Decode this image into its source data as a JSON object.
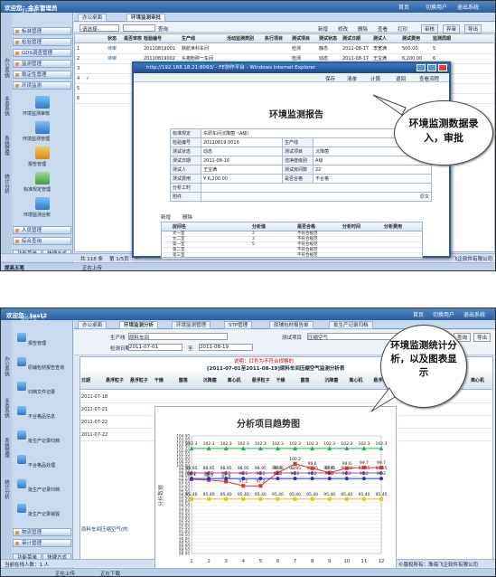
{
  "s1": {
    "banner": {
      "welcome": "欢迎您：金东管理员",
      "sub": "当前单位：A",
      "links": [
        "首页",
        "切换用户",
        "退出系统"
      ]
    },
    "tab": "办公桌面",
    "tab2": "环境监测审批",
    "filter": {
      "select": "-请选择-",
      "btn": "查询"
    },
    "toolbar": [
      "新增",
      "修改",
      "删除",
      "查看",
      "打印",
      "审核",
      "弃审",
      "导出"
    ],
    "cols": [
      "",
      "",
      "状态",
      "是否审核",
      "检验编号",
      "生产线",
      "活动监测类别",
      "执行项目",
      "测试项目",
      "测试状态",
      "测试日期",
      "测试人",
      "测试费用",
      "监测周期"
    ],
    "rows": [
      [
        "1",
        "",
        "待审",
        "",
        "20110819001",
        "默航世科车间",
        "",
        "",
        "检测",
        "静态",
        "2011-08-17",
        "李宽满",
        "500.00",
        "5"
      ],
      [
        "2",
        "",
        "待审",
        "",
        "20110819002",
        "头孢粉碎一车间",
        "",
        "",
        "检测",
        "动态",
        "2011-08-17",
        "王宝满",
        "6,200.00",
        "6"
      ],
      [
        "3",
        "",
        "",
        "",
        "",
        "",
        "",
        "",
        "",
        "",
        "",
        "",
        "",
        ""
      ],
      [
        "4",
        "✓",
        "",
        "",
        "",
        "",
        "",
        "",
        "",
        "",
        "",
        "",
        "",
        ""
      ],
      [
        "5",
        "",
        "",
        "",
        "",
        "",
        "",
        "",
        "",
        "",
        "",
        "",
        "",
        ""
      ],
      [
        "6",
        "",
        "",
        "",
        "",
        "",
        "",
        "",
        "",
        "",
        "",
        "",
        "",
        ""
      ]
    ],
    "status": [
      "共 118 条",
      "第 1/5页",
      "10"
    ],
    "status_right": "飞企软件有限公司",
    "taskbar": [
      "提高五笔",
      "正在上传"
    ],
    "side": {
      "vtabs": [
        "办公系统",
        "业务系统",
        "系统管理",
        "统计分析"
      ],
      "mods": [
        "标准管理",
        "检验管理",
        "GDS调查管理",
        "监测管理",
        "稳定性管理",
        "环境监测"
      ],
      "icons": [
        "环境监测审核",
        "环境监测管理",
        "报告管理",
        "标准规定管理",
        "环境监测台账"
      ],
      "mods2": [
        "人员管理",
        "综合查询"
      ],
      "bottom": [
        "功能菜单",
        "快捷方式"
      ]
    },
    "win": {
      "title": "http://192.168.18.21:8093/ - FE协作平台 - Windows Internet Explorer",
      "tools": [
        "保存",
        "清单",
        "计算",
        "退回",
        "查看流程"
      ],
      "report_title": "环境监测报告",
      "f": {
        "l1": "标准规定",
        "v1": "东研车间沉降菌（A级）",
        "l2": "检验编号",
        "v2": "20110819 0016",
        "l3": "生产线",
        "v3": "",
        "l4": "测试状态",
        "v4": "动态",
        "l5": "测试项目",
        "v5": "沉降菌",
        "l6": "测试日期",
        "v6": "2011-08-16",
        "l7": "洁净度级别",
        "v7": "A级",
        "l8": "测试人",
        "v8": "王宝满",
        "l9": "测试房间数",
        "v9": "22",
        "l10": "是否合格",
        "v10": "不合格",
        "l11": "测试费用",
        "v11": "¥ 6,200.00",
        "l12": "分析工时",
        "v12": "",
        "l13": "附件",
        "v13": "原文"
      },
      "sub_tools": [
        "新增",
        "删除"
      ],
      "sub_cols": [
        "房间名",
        "分析值",
        "是否合格",
        "分析时间",
        "分析费用"
      ],
      "sub_rows": [
        [
          "文一室",
          "2",
          "不符合规范"
        ],
        [
          "文二室",
          "3",
          "不符合规范"
        ],
        [
          "第一室",
          "5",
          "不符合规范"
        ],
        [
          "第二室",
          "",
          "不符合规范"
        ],
        [
          "第三室",
          "",
          "不符合规范"
        ]
      ]
    },
    "callout": "环境监测数据录入，审批"
  },
  "s2": {
    "banner": {
      "welcome": "欢迎您：test2",
      "sub": "当前单位：A",
      "links": [
        "首页",
        "切换用户",
        "退出系统"
      ]
    },
    "tabs": [
      "办公桌面",
      "环境监测分析",
      "环境监测管理",
      "STP管理",
      "原辅包材报告单",
      "批生产记录归档"
    ],
    "filter": {
      "l1": "生产线",
      "v1": "原料车间",
      "l2": "测试项目",
      "v2": "压缩空气",
      "l3": "检测日期",
      "d1": "2011-07-01",
      "d2": "2011-08-19",
      "to": "至",
      "btn": "查询",
      "btn2": "导出"
    },
    "legend_note": "说明：红色为不符合规格的",
    "table_title": "[2011-07-01至2011-08-19]原料车间压缩空气监测分析表",
    "cols": [
      "日期",
      "悬浮粒子",
      "悬浮粒子",
      "干燥",
      "菌落",
      "沉降菌",
      "离心机",
      "悬浮粒子",
      "干燥",
      "菌落",
      "沉降菌",
      "离心机",
      "悬浮粒子",
      "干燥",
      "菌落",
      "沉降菌",
      "离心机"
    ],
    "dates": [
      "2011-07-18",
      "2011-07-21",
      "2011-07-22",
      "2011-07-22"
    ],
    "row_label": "原料车间压缩空气(的",
    "side": {
      "vtabs": [
        "办公系统",
        "业务系统",
        "系统管理",
        "统计分析"
      ],
      "items": [
        "报告管理",
        "原辅包材报告查询",
        "归档文件记录",
        "不合格品信息",
        "批生产记录归档",
        "不合格品处理",
        "批生产记录归档",
        "批生产记录销毁"
      ],
      "mods": [
        "物流管理",
        "审计管理"
      ],
      "bottom": [
        "功能菜单",
        "快捷方式"
      ]
    },
    "status": [
      "当前在线人数：1 人"
    ],
    "status_right": "©版权所有：珠海飞企软件有限公司",
    "taskbar": [
      "正在上传",
      "正在下载"
    ],
    "callout": "环境监测统计分析，以及图表显示"
  },
  "chart_data": {
    "type": "line",
    "title": "分析项目趋势图",
    "xlabel": "",
    "ylabel": "分析数据",
    "x": [
      1,
      2,
      3,
      4,
      5,
      6,
      7,
      8,
      9,
      10,
      11,
      12
    ],
    "ylim": [
      88,
      104
    ],
    "yticks": [
      88.0,
      88.5,
      89.0,
      89.5,
      90.0,
      90.5,
      91.0,
      91.5,
      92.0,
      92.5,
      93.0,
      93.5,
      94.0,
      94.5,
      95.0,
      95.5,
      96.0,
      96.5,
      97.0,
      97.5,
      98.0,
      98.5,
      99.0,
      99.5,
      100.0,
      100.5,
      101.0,
      101.5,
      102.0,
      102.5,
      103.0,
      103.5,
      104.0
    ],
    "series": [
      {
        "color": "#22b04a",
        "values": [
          102.3,
          102.3,
          102.3,
          102.3,
          102.3,
          102.3,
          102.3,
          102.3,
          102.3,
          102.3,
          102.3,
          102.3
        ]
      },
      {
        "color": "#b04ab0",
        "values": [
          98.95,
          98.95,
          98.95,
          98.95,
          98.95,
          98.95,
          98.95,
          98.95,
          98.95,
          98.95,
          98.95,
          98.95
        ]
      },
      {
        "color": "#e03030",
        "values": [
          98.1,
          98.0,
          97.8,
          97.2,
          97.2,
          99.0,
          100.2,
          99.6,
          99.0,
          99.6,
          99.7,
          99.7
        ]
      },
      {
        "color": "#2233cc",
        "values": [
          98.2,
          98.2,
          98.2,
          98.2,
          98.2,
          98.2,
          98.2,
          98.2,
          98.2,
          98.2,
          98.2,
          98.2
        ]
      },
      {
        "color": "#d8cc20",
        "values": [
          95.4,
          95.4,
          95.4,
          95.4,
          95.4,
          95.4,
          95.4,
          95.4,
          95.4,
          95.4,
          95.4,
          95.4
        ]
      }
    ],
    "labels": {
      "s0": "102.3",
      "s1": "98.95",
      "s3": "98.2",
      "s4": "95.40",
      "s2": [
        "98.1",
        "98.0",
        "97.8",
        "97.2",
        "97.2",
        "99.0",
        "100.2",
        "99.6",
        "99.0",
        "99.6",
        "99.7",
        "99.7"
      ]
    },
    "grid": true
  }
}
